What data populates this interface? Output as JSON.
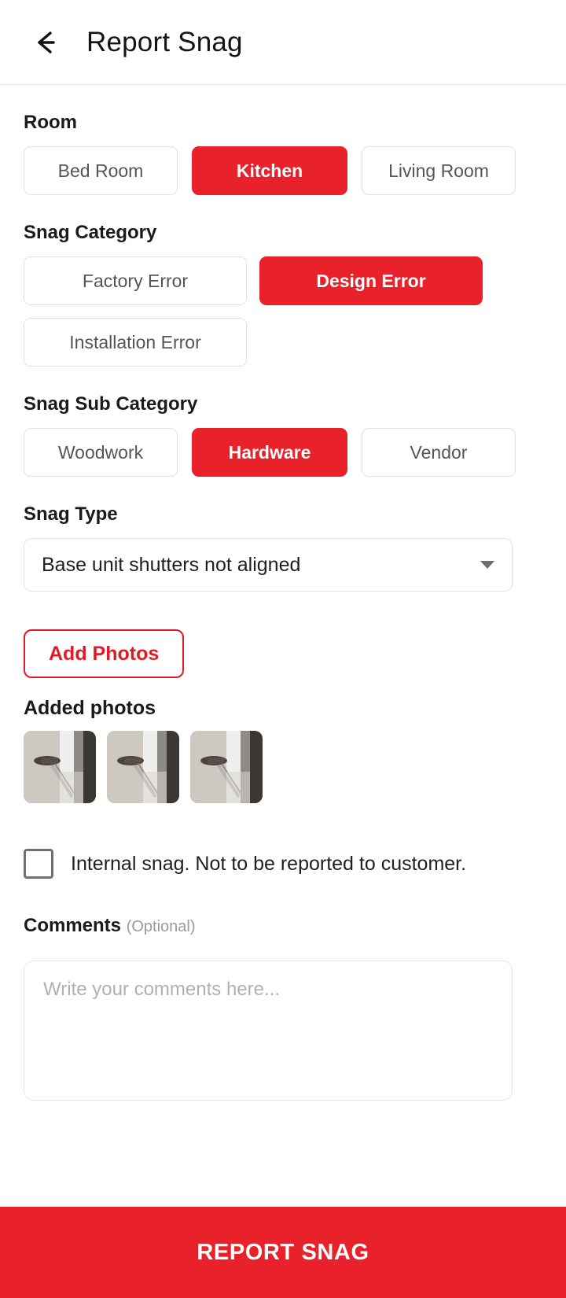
{
  "header": {
    "back_icon": "arrow-left-icon",
    "title": "Report Snag"
  },
  "room": {
    "label": "Room",
    "options": [
      {
        "label": "Bed Room",
        "selected": false
      },
      {
        "label": "Kitchen",
        "selected": true
      },
      {
        "label": "Living Room",
        "selected": false
      }
    ]
  },
  "snag_category": {
    "label": "Snag Category",
    "options": [
      {
        "label": "Factory Error",
        "selected": false
      },
      {
        "label": "Design Error",
        "selected": true
      },
      {
        "label": "Installation Error",
        "selected": false
      }
    ]
  },
  "snag_sub_category": {
    "label": "Snag Sub Category",
    "options": [
      {
        "label": "Woodwork",
        "selected": false
      },
      {
        "label": "Hardware",
        "selected": true
      },
      {
        "label": "Vendor",
        "selected": false
      }
    ]
  },
  "snag_type": {
    "label": "Snag Type",
    "value": "Base unit shutters not aligned",
    "caret_icon": "chevron-down-icon"
  },
  "photos": {
    "add_button_label": "Add Photos",
    "added_label": "Added photos",
    "thumbnails": [
      {
        "alt": "cabinet-hinge-photo"
      },
      {
        "alt": "cabinet-hinge-photo"
      },
      {
        "alt": "cabinet-hinge-photo"
      }
    ]
  },
  "internal_snag": {
    "label": "Internal snag. Not to be reported to customer.",
    "checked": false
  },
  "comments": {
    "label": "Comments",
    "optional_suffix": "(Optional)",
    "placeholder": "Write your comments here...",
    "value": ""
  },
  "submit": {
    "label": "REPORT SNAG"
  },
  "colors": {
    "accent_red": "#e8212a",
    "outline_red": "#e01b24",
    "text_dark": "#1a1a1a",
    "text_muted": "#555555",
    "border": "#e2e2e2"
  }
}
